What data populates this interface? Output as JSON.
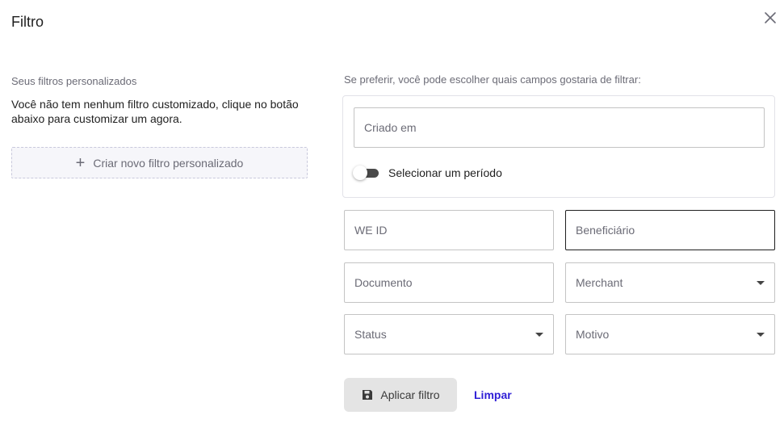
{
  "modal": {
    "title": "Filtro",
    "close_icon": "close-icon"
  },
  "custom_filters": {
    "label": "Seus filtros personalizados",
    "empty_message": "Você não tem nenhum filtro customizado, clique no botão abaixo para customizar um agora.",
    "create_button_label": "Criar novo filtro personalizado",
    "create_button_icon": "plus-icon"
  },
  "fields_section": {
    "label": "Se preferir, você pode escolher quais campos gostaria de filtrar:",
    "created_at": {
      "placeholder": "Criado em",
      "value": ""
    },
    "period_toggle": {
      "label": "Selecionar um período",
      "on": false
    },
    "we_id": {
      "placeholder": "WE ID",
      "value": ""
    },
    "beneficiary": {
      "placeholder": "Beneficiário",
      "value": "",
      "focused": true
    },
    "document": {
      "placeholder": "Documento",
      "value": ""
    },
    "merchant": {
      "placeholder": "Merchant",
      "selected": ""
    },
    "status": {
      "placeholder": "Status",
      "selected": ""
    },
    "reason": {
      "placeholder": "Motivo",
      "selected": ""
    }
  },
  "actions": {
    "apply_label": "Aplicar filtro",
    "apply_icon": "save-icon",
    "clear_label": "Limpar"
  },
  "colors": {
    "accent_link": "#2f1fd6",
    "muted_text": "#6b6b76",
    "apply_button_bg": "#e4e4e4"
  }
}
